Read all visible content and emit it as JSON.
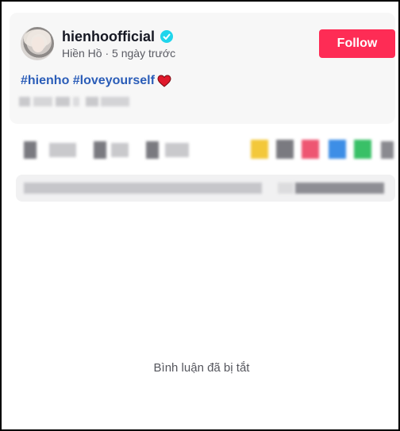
{
  "post": {
    "username": "hienhoofficial",
    "display_name": "Hiền Hồ",
    "separator": " · ",
    "time_ago": "5 ngày trước",
    "follow_label": "Follow",
    "caption": "#hienho #loveyourself"
  },
  "icons": {
    "avatar": "profile-photo",
    "verified": "verified-badge-icon",
    "heart": "red-heart-emoji"
  },
  "comments": {
    "disabled_text": "Bình luận đã bị tắt"
  },
  "colors": {
    "follow_button": "#fe2c55",
    "hashtag": "#2b5db8",
    "verified": "#20d5ec",
    "card_background": "#f7f7f7"
  }
}
